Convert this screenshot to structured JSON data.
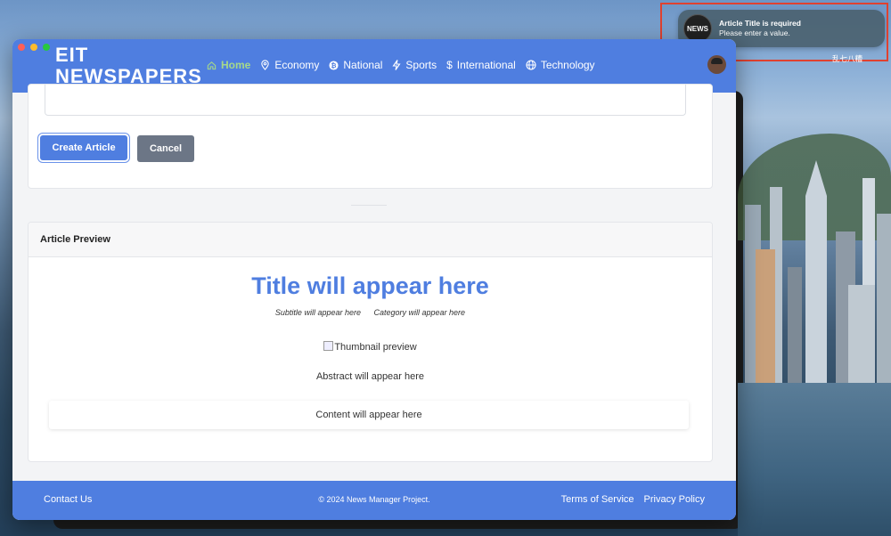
{
  "notification": {
    "icon_text": "NEWS",
    "title": "Article Title is required",
    "body": "Please enter a value."
  },
  "desktop": {
    "user_label": "乱七八糟"
  },
  "brand": {
    "line1": "EIT",
    "line2": "NEWSPAPERS"
  },
  "nav": {
    "items": [
      {
        "label": "Home",
        "icon": "home-icon",
        "active": true
      },
      {
        "label": "Economy",
        "icon": "location-pin-icon"
      },
      {
        "label": "National",
        "icon": "bitcoin-icon"
      },
      {
        "label": "Sports",
        "icon": "lightning-icon"
      },
      {
        "label": "International",
        "icon": "dollar-icon"
      },
      {
        "label": "Technology",
        "icon": "globe-icon"
      }
    ]
  },
  "form": {
    "create_label": "Create Article",
    "cancel_label": "Cancel"
  },
  "preview": {
    "header": "Article Preview",
    "title": "Title will appear here",
    "subtitle": "Subtitle will appear here",
    "category": "Category will appear here",
    "thumbnail_alt": "Thumbnail preview",
    "abstract": "Abstract will appear here",
    "content": "Content will appear here"
  },
  "footer": {
    "contact": "Contact Us",
    "copyright": "© 2024 News Manager Project.",
    "terms": "Terms of Service",
    "privacy": "Privacy Policy"
  },
  "colors": {
    "primary": "#4f7ee0",
    "active_nav": "#a6d98a",
    "cancel": "#6c7686",
    "alert_outline": "#e0412f"
  }
}
